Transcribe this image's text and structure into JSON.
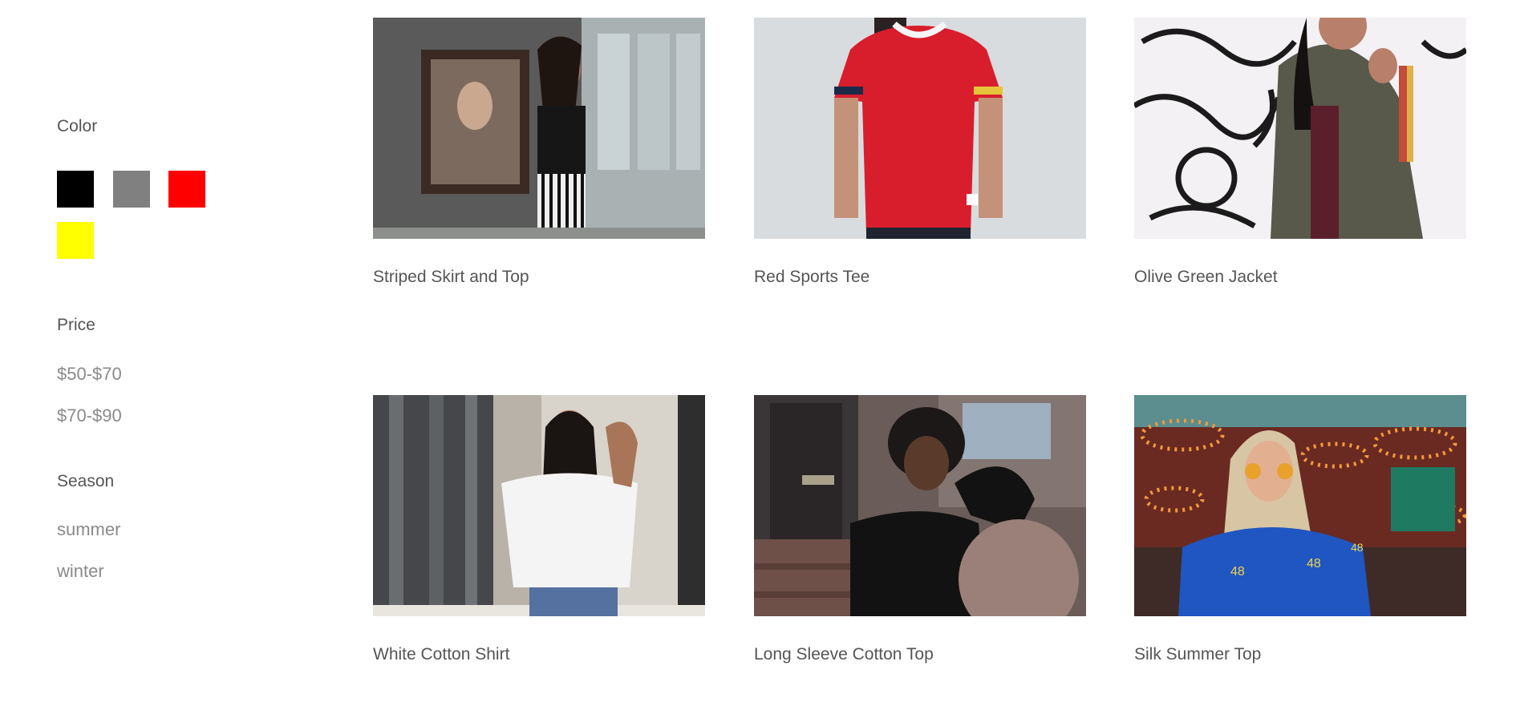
{
  "filters": {
    "color": {
      "title": "Color",
      "swatches": [
        {
          "name": "black",
          "hex": "#000000"
        },
        {
          "name": "gray",
          "hex": "#808080"
        },
        {
          "name": "red",
          "hex": "#ff0000"
        },
        {
          "name": "yellow",
          "hex": "#ffff00"
        }
      ]
    },
    "price": {
      "title": "Price",
      "options": [
        "$50-$70",
        "$70-$90"
      ]
    },
    "season": {
      "title": "Season",
      "options": [
        "summer",
        "winter"
      ]
    }
  },
  "products": [
    {
      "name": "Striped Skirt and Top",
      "photo": "woman-black-top-striped-skirt-photo"
    },
    {
      "name": "Red Sports Tee",
      "photo": "red-tshirt-photo"
    },
    {
      "name": "Olive Green Jacket",
      "photo": "olive-jacket-graffiti-photo"
    },
    {
      "name": "White Cotton Shirt",
      "photo": "white-shirt-street-photo"
    },
    {
      "name": "Long Sleeve Cotton Top",
      "photo": "black-long-sleeve-top-photo"
    },
    {
      "name": "Silk Summer Top",
      "photo": "blue-silk-top-carnival-photo"
    }
  ]
}
